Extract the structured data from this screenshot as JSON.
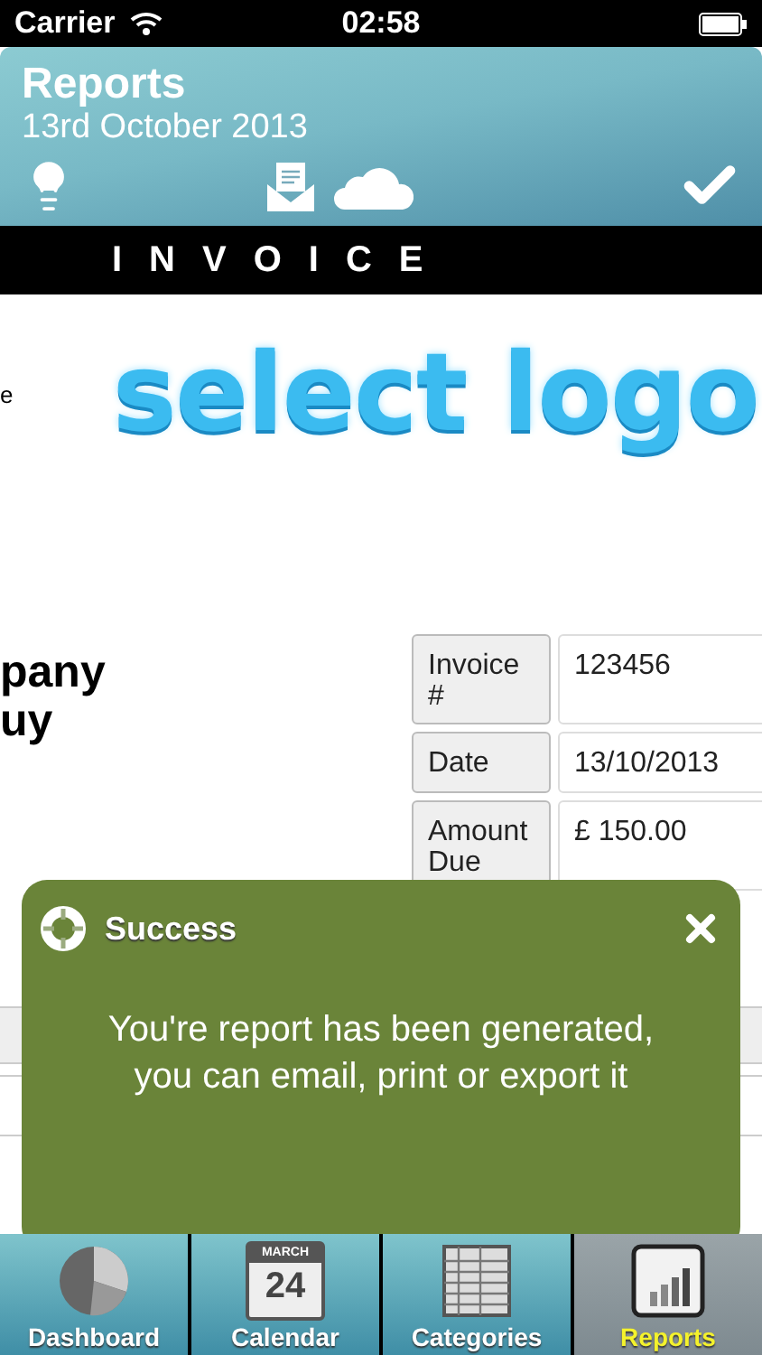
{
  "status_bar": {
    "carrier": "Carrier",
    "time": "02:58"
  },
  "header": {
    "title": "Reports",
    "subtitle": "13rd October 2013"
  },
  "invoice_bar": {
    "title": "INVOICE"
  },
  "invoice": {
    "left_text": "e",
    "logo_placeholder": "select logo",
    "company_lines": [
      "pany",
      "uy"
    ],
    "details": [
      {
        "label": "Invoice #",
        "value": "123456"
      },
      {
        "label": "Date",
        "value": "13/10/2013"
      },
      {
        "label": "Amount Due",
        "value": "£ 150.00"
      }
    ]
  },
  "toast": {
    "title": "Success",
    "message": "You're report has been generated, you can email, print or export it"
  },
  "tab_bar": [
    {
      "label": "Dashboard",
      "kind": "pie",
      "selected": false
    },
    {
      "label": "Calendar",
      "kind": "calendar",
      "selected": false,
      "icon_month": "MARCH",
      "icon_day": "24"
    },
    {
      "label": "Categories",
      "kind": "sheet",
      "selected": false
    },
    {
      "label": "Reports",
      "kind": "report",
      "selected": true
    }
  ]
}
